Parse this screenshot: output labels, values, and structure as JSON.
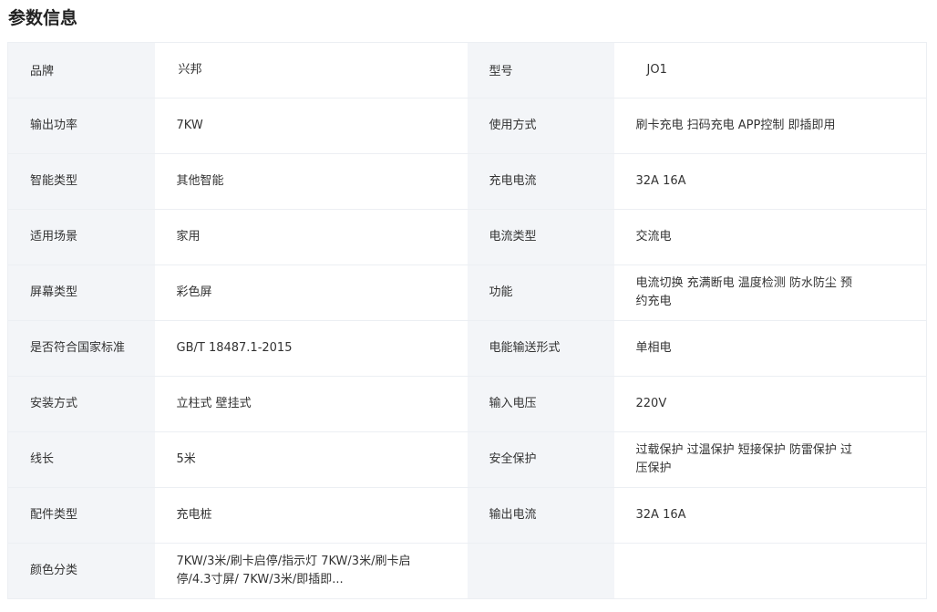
{
  "section": {
    "title": "参数信息"
  },
  "rows": [
    {
      "k1": "品牌",
      "v1": "兴邦",
      "k2": "型号",
      "v2": "JO1"
    },
    {
      "k1": "输出功率",
      "v1": "7KW",
      "k2": "使用方式",
      "v2": "刷卡充电 扫码充电 APP控制 即插即用"
    },
    {
      "k1": "智能类型",
      "v1": "其他智能",
      "k2": "充电电流",
      "v2": "32A 16A"
    },
    {
      "k1": "适用场景",
      "v1": "家用",
      "k2": "电流类型",
      "v2": "交流电"
    },
    {
      "k1": "屏幕类型",
      "v1": "彩色屏",
      "k2": "功能",
      "v2": "电流切换 充满断电 温度检测 防水防尘 预约充电"
    },
    {
      "k1": "是否符合国家标准",
      "v1": "GB/T 18487.1-2015",
      "k2": "电能输送形式",
      "v2": "单相电"
    },
    {
      "k1": "安装方式",
      "v1": "立柱式 壁挂式",
      "k2": "输入电压",
      "v2": "220V"
    },
    {
      "k1": "线长",
      "v1": "5米",
      "k2": "安全保护",
      "v2": "过载保护 过温保护 短接保护 防雷保护 过压保护"
    },
    {
      "k1": "配件类型",
      "v1": "充电桩",
      "k2": "输出电流",
      "v2": "32A 16A"
    },
    {
      "k1": "颜色分类",
      "v1": "7KW/3米/刷卡启停/指示灯 7KW/3米/刷卡启停/4.3寸屏/ 7KW/3米/即插即...",
      "k2": "",
      "v2": ""
    }
  ]
}
